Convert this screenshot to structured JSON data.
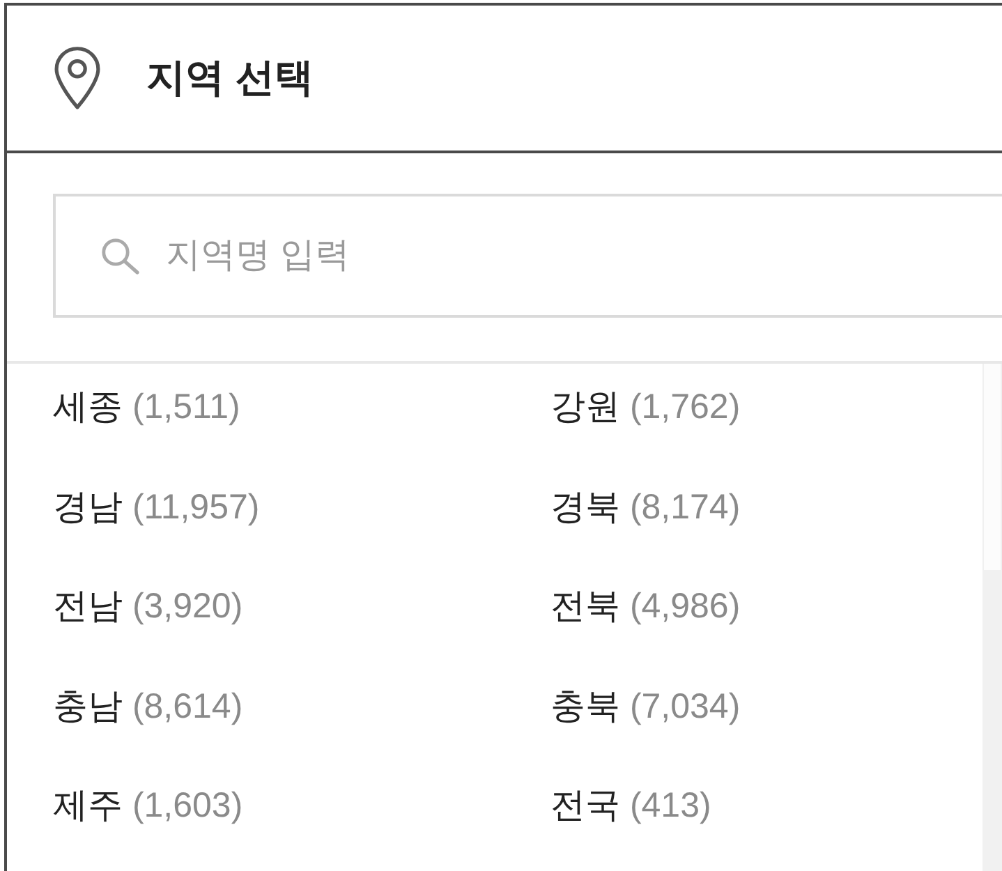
{
  "header": {
    "title": "지역 선택"
  },
  "search": {
    "placeholder": "지역명 입력"
  },
  "regions": [
    {
      "name": "세종",
      "count": "(1,511)"
    },
    {
      "name": "강원",
      "count": "(1,762)"
    },
    {
      "name": "경남",
      "count": "(11,957)"
    },
    {
      "name": "경북",
      "count": "(8,174)"
    },
    {
      "name": "전남",
      "count": "(3,920)"
    },
    {
      "name": "전북",
      "count": "(4,986)"
    },
    {
      "name": "충남",
      "count": "(8,614)"
    },
    {
      "name": "충북",
      "count": "(7,034)"
    },
    {
      "name": "제주",
      "count": "(1,603)"
    },
    {
      "name": "전국",
      "count": "(413)"
    }
  ]
}
